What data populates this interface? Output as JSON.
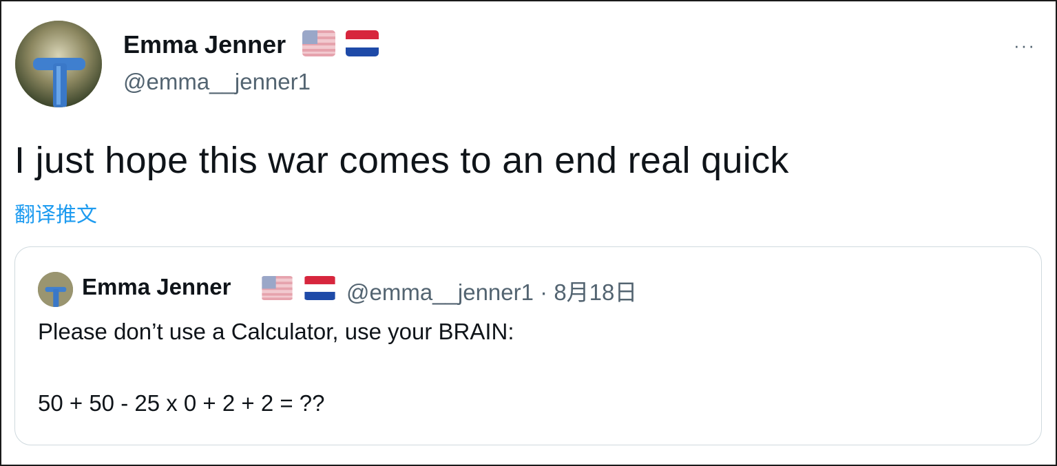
{
  "tweet": {
    "author": {
      "name": "Emma Jenner",
      "handle": "@emma__jenner1",
      "flags": [
        "us-flag-icon",
        "netherlands-flag-icon"
      ]
    },
    "more_label": "···",
    "text": "I just hope this war comes to an end real quick",
    "translate_label": "翻译推文"
  },
  "quoted": {
    "author": {
      "name": "Emma Jenner",
      "handle": "@emma__jenner1",
      "flags": [
        "us-flag-icon",
        "netherlands-flag-icon"
      ]
    },
    "separator": " · ",
    "date": "8月18日",
    "line1": "Please don’t use a Calculator, use your BRAIN:",
    "line2": "50 + 50 - 25 x 0 + 2 + 2 = ??"
  },
  "colors": {
    "text": "#0f1419",
    "secondary": "#536471",
    "link": "#1d9bf0",
    "border": "#cfd9de"
  }
}
